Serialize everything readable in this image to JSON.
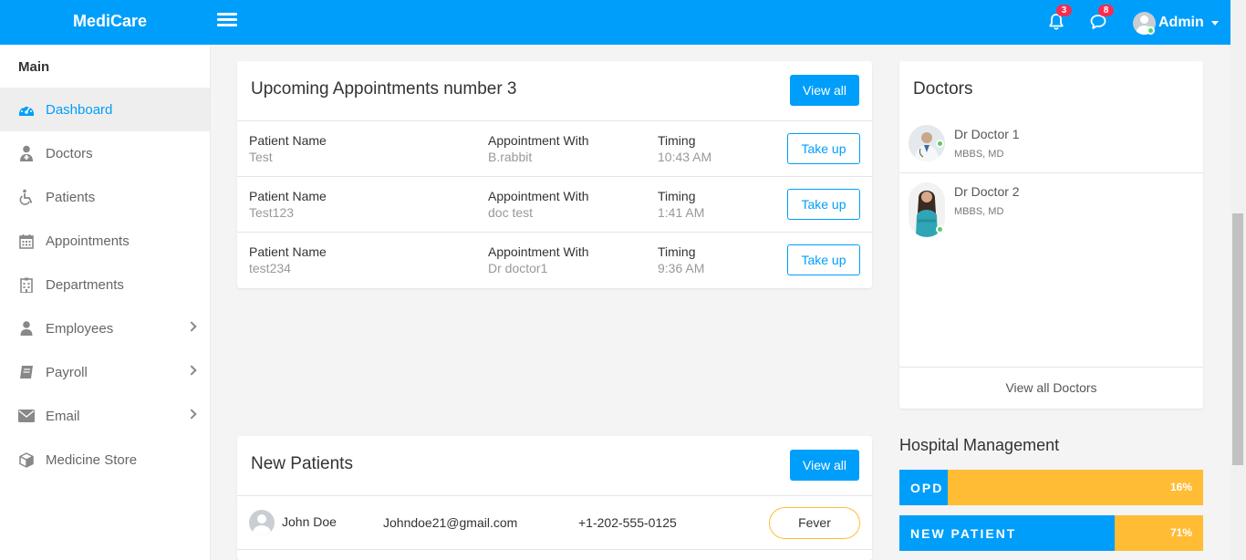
{
  "header": {
    "logo": "MediCare",
    "notifications_count": "3",
    "messages_count": "8",
    "user_name": "Admin"
  },
  "sidebar": {
    "title": "Main",
    "items": [
      {
        "label": "Dashboard",
        "icon": "dashboard-icon",
        "active": true
      },
      {
        "label": "Doctors",
        "icon": "doctor-icon"
      },
      {
        "label": "Patients",
        "icon": "wheelchair-icon"
      },
      {
        "label": "Appointments",
        "icon": "calendar-icon"
      },
      {
        "label": "Departments",
        "icon": "hospital-icon"
      },
      {
        "label": "Employees",
        "icon": "user-icon",
        "has_submenu": true
      },
      {
        "label": "Payroll",
        "icon": "book-icon",
        "has_submenu": true
      },
      {
        "label": "Email",
        "icon": "envelope-icon",
        "has_submenu": true
      },
      {
        "label": "Medicine Store",
        "icon": "cube-icon"
      }
    ]
  },
  "appointments": {
    "title": "Upcoming Appointments number 3",
    "view_all": "View all",
    "col_patient": "Patient Name",
    "col_with": "Appointment With",
    "col_timing": "Timing",
    "action": "Take up",
    "rows": [
      {
        "patient": "Test",
        "with": "B.rabbit",
        "timing": "10:43 AM"
      },
      {
        "patient": "Test123",
        "with": "doc test",
        "timing": "1:41 AM"
      },
      {
        "patient": "test234",
        "with": "Dr doctor1",
        "timing": "9:36 AM"
      }
    ]
  },
  "doctors": {
    "title": "Doctors",
    "list": [
      {
        "name": "Dr Doctor 1",
        "degree": "MBBS, MD"
      },
      {
        "name": "Dr Doctor 2",
        "degree": "MBBS, MD"
      }
    ],
    "view_all": "View all Doctors"
  },
  "new_patients": {
    "title": "New Patients",
    "view_all": "View all",
    "rows": [
      {
        "name": "John Doe",
        "email": "Johndoe21@gmail.com",
        "phone": "+1-202-555-0125",
        "condition": "Fever"
      }
    ]
  },
  "hospital_management": {
    "title": "Hospital Management",
    "bars": [
      {
        "label": "OPD",
        "percent": 16,
        "percent_text": "16%"
      },
      {
        "label": "NEW PATIENT",
        "percent": 71,
        "percent_text": "71%"
      }
    ]
  },
  "colors": {
    "primary": "#009efb",
    "warning": "#ffbc34",
    "danger": "#f62d51",
    "success": "#55ce63"
  }
}
